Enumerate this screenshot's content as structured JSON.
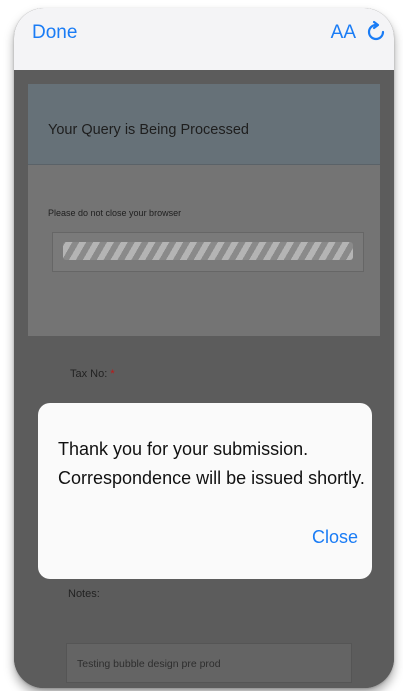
{
  "browser": {
    "done_label": "Done",
    "text_size_label": "AA",
    "reload_icon": "reload-icon"
  },
  "modal": {
    "title": "Your Query is Being Processed",
    "note": "Please do not close your browser",
    "progress_percent": 100
  },
  "form": {
    "tax_label": "Tax No:",
    "required_marker": "*",
    "notes_label": "Notes:",
    "notes_value": "Testing bubble design pre prod"
  },
  "alert": {
    "line1": "Thank you for your submission.",
    "line2": "Correspondence will be issued shortly.",
    "close_label": "Close"
  },
  "colors": {
    "ios_blue": "#1a7cf5",
    "overlay_gray": "#5c5c5c",
    "required_red": "#c01818"
  }
}
